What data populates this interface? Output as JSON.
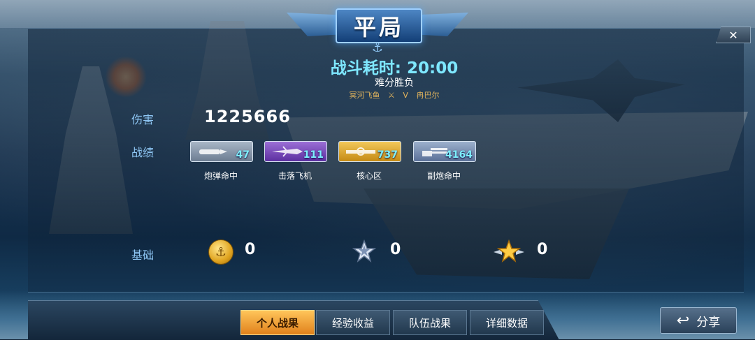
{
  "title": "平局",
  "duration": {
    "label": "战斗耗时:",
    "value": "20:00"
  },
  "result_text": "难分胜负",
  "versus": {
    "left_player": "冥河飞鱼",
    "vs_mark": "V",
    "right_player": "冉巴尔"
  },
  "damage": {
    "label": "伤害",
    "value": "1225666"
  },
  "achievements": {
    "label": "战绩",
    "items": [
      {
        "name": "炮弹命中",
        "value": "47",
        "color": "#8b9bb0",
        "icon": "shell-icon"
      },
      {
        "name": "击落飞机",
        "value": "111",
        "color": "#7b4fc0",
        "icon": "plane-icon"
      },
      {
        "name": "核心区",
        "value": "737",
        "color": "#d9a22a",
        "icon": "core-icon"
      },
      {
        "name": "副炮命中",
        "value": "4164",
        "color": "#6f86a8",
        "icon": "gun-icon"
      }
    ]
  },
  "base": {
    "label": "基础",
    "items": [
      {
        "icon": "gold-coin-icon",
        "value": "0"
      },
      {
        "icon": "silver-star-icon",
        "value": "0"
      },
      {
        "icon": "gold-star-badge-icon",
        "value": "0"
      }
    ]
  },
  "tabs": [
    {
      "label": "个人战果",
      "active": true
    },
    {
      "label": "经验收益",
      "active": false
    },
    {
      "label": "队伍战果",
      "active": false
    },
    {
      "label": "详细数据",
      "active": false
    }
  ],
  "share_label": "分享"
}
